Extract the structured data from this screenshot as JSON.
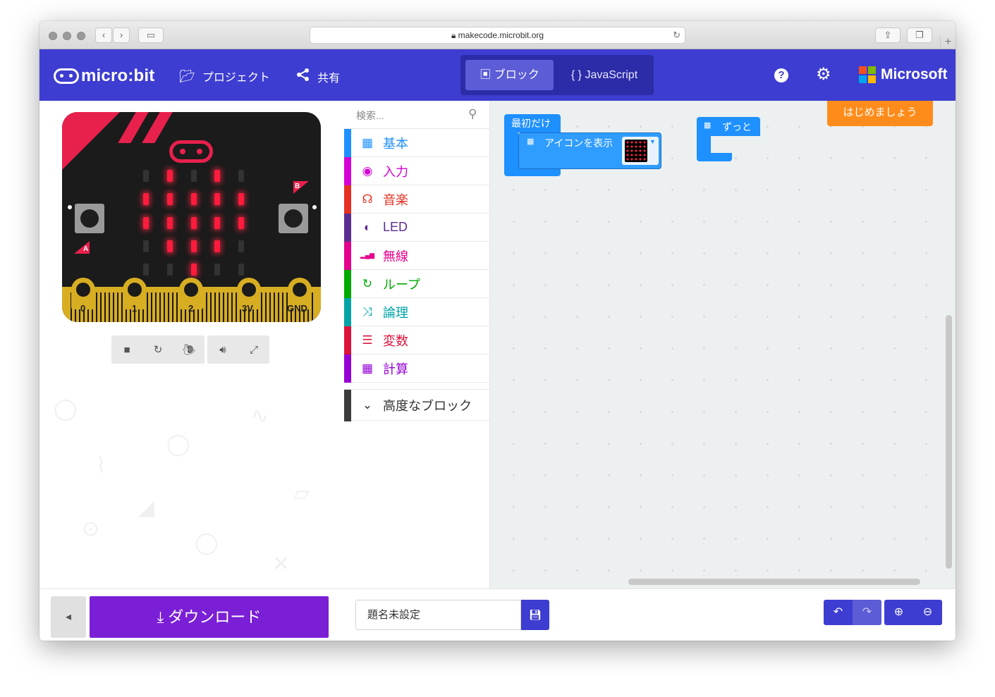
{
  "browser": {
    "url": "makecode.microbit.org"
  },
  "header": {
    "logo": "micro:bit",
    "projects_label": "プロジェクト",
    "share_label": "共有",
    "blocks_label": "ブロック",
    "javascript_label": "JavaScript",
    "brand": "Microsoft",
    "colors": {
      "header_bg": "#3d3dd1",
      "ms_red": "#f25022",
      "ms_green": "#7fba00",
      "ms_blue": "#00a4ef",
      "ms_yellow": "#ffb900"
    }
  },
  "simulator": {
    "button_a": "A",
    "button_b": "B",
    "pins": [
      "0",
      "1",
      "2",
      "3V",
      "GND"
    ],
    "led_matrix": [
      [
        0,
        1,
        0,
        1,
        0
      ],
      [
        1,
        1,
        1,
        1,
        1
      ],
      [
        1,
        1,
        1,
        1,
        1
      ],
      [
        0,
        1,
        1,
        1,
        0
      ],
      [
        0,
        0,
        1,
        0,
        0
      ]
    ],
    "controls": [
      "stop-icon",
      "restart-icon",
      "slow-mo-icon",
      "sound-icon",
      "fullscreen-icon"
    ]
  },
  "toolbox": {
    "search_placeholder": "検索...",
    "categories": [
      {
        "label": "基本",
        "color": "#1e90ff",
        "icon": "grid-icon"
      },
      {
        "label": "入力",
        "color": "#d400d4",
        "icon": "target-icon"
      },
      {
        "label": "音楽",
        "color": "#e63022",
        "icon": "headphones-icon"
      },
      {
        "label": "LED",
        "color": "#5c2d91",
        "icon": "toggle-icon"
      },
      {
        "label": "無線",
        "color": "#e3008c",
        "icon": "signal-icon"
      },
      {
        "label": "ループ",
        "color": "#00aa00",
        "icon": "loop-icon"
      },
      {
        "label": "論理",
        "color": "#00a4a6",
        "icon": "shuffle-icon"
      },
      {
        "label": "変数",
        "color": "#dc143c",
        "icon": "list-icon"
      },
      {
        "label": "計算",
        "color": "#9400d3",
        "icon": "calculator-icon"
      }
    ],
    "advanced_label": "高度なブロック"
  },
  "workspace": {
    "start_button": "はじめましょう",
    "on_start_label": "最初だけ",
    "show_icon_label": "アイコンを表示",
    "forever_label": "ずっと"
  },
  "footer": {
    "download_label": "ダウンロード",
    "project_name": "題名未設定"
  }
}
